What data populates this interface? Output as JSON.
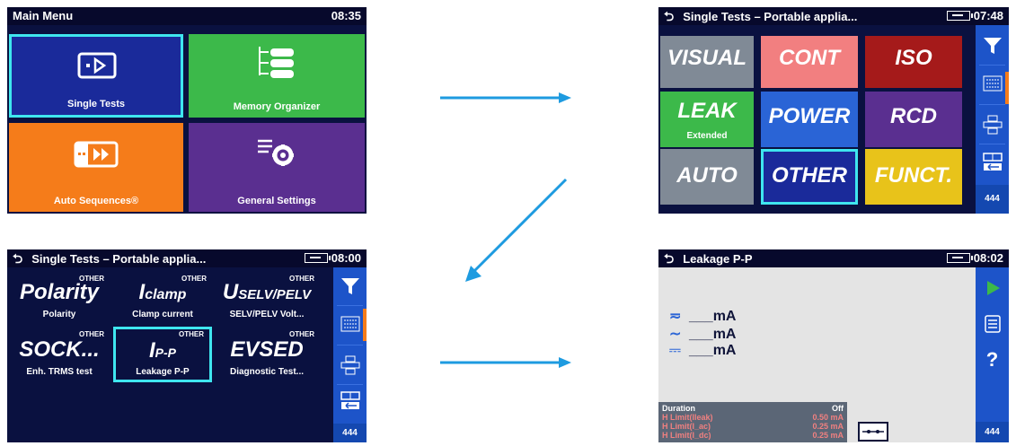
{
  "main_menu": {
    "title": "Main Menu",
    "time": "08:35",
    "tiles": [
      {
        "label": "Single Tests",
        "color": "#1a2a9a",
        "icon": "single-tests-icon"
      },
      {
        "label": "Memory Organizer",
        "color": "#3cb94a",
        "icon": "memory-organizer-icon"
      },
      {
        "label": "Auto Sequences®",
        "color": "#f57c1a",
        "icon": "auto-sequences-icon"
      },
      {
        "label": "General Settings",
        "color": "#5a2f90",
        "icon": "general-settings-icon"
      }
    ]
  },
  "single_tests": {
    "title": "Single Tests – Portable applia...",
    "time": "07:48",
    "tiles": [
      {
        "label": "VISUAL",
        "sub": "",
        "color": "#808a96"
      },
      {
        "label": "CONT",
        "sub": "",
        "color": "#f27f80"
      },
      {
        "label": "ISO",
        "sub": "",
        "color": "#a51a1a"
      },
      {
        "label": "LEAK",
        "sub": "Extended",
        "color": "#3cb94a"
      },
      {
        "label": "POWER",
        "sub": "",
        "color": "#2a64d6"
      },
      {
        "label": "RCD",
        "sub": "",
        "color": "#5a2f90"
      },
      {
        "label": "AUTO",
        "sub": "",
        "color": "#808a96"
      },
      {
        "label": "OTHER",
        "sub": "",
        "color": "#1a2a9a"
      },
      {
        "label": "FUNCT.",
        "sub": "",
        "color": "#e8c31a"
      }
    ],
    "side_buttons": [
      "filter-icon",
      "grid-icon",
      "move-icon",
      "swap-icon",
      "more-icon"
    ],
    "more_label": "444"
  },
  "other_tests": {
    "title": "Single Tests – Portable applia...",
    "time": "08:00",
    "category": "OTHER",
    "tiles": [
      {
        "main": "Polarity",
        "sub": "Polarity"
      },
      {
        "main": "I",
        "main_sub": "clamp",
        "sub": "Clamp current"
      },
      {
        "main": "U",
        "main_sub": "SELV/PELV",
        "sub": "SELV/PELV Volt..."
      },
      {
        "main": "SOCK...",
        "sub": "Enh. TRMS test"
      },
      {
        "main": "I",
        "main_sub": "P-P",
        "sub": "Leakage P-P"
      },
      {
        "main": "EVSED",
        "sub": "Diagnostic Test..."
      }
    ],
    "more_label": "444"
  },
  "leakage": {
    "title": "Leakage P-P",
    "time": "08:02",
    "readings": [
      {
        "symbol": "≂",
        "value": "___",
        "unit": "mA"
      },
      {
        "symbol": "∼",
        "value": "___",
        "unit": "mA"
      },
      {
        "symbol": "⎓",
        "value": "___",
        "unit": "mA"
      }
    ],
    "limits": [
      {
        "name": "Duration",
        "value": "Off"
      },
      {
        "name": "H Limit(Ileak)",
        "value": "0.50 mA"
      },
      {
        "name": "H Limit(I_ac)",
        "value": "0.25 mA"
      },
      {
        "name": "H Limit(I_dc)",
        "value": "0.25 mA"
      }
    ],
    "help_label": "?",
    "more_label": "444"
  },
  "colors": {
    "accent_select": "#3fe6ef",
    "arrow": "#1e9be0",
    "side_bar": "#1d54c9"
  }
}
